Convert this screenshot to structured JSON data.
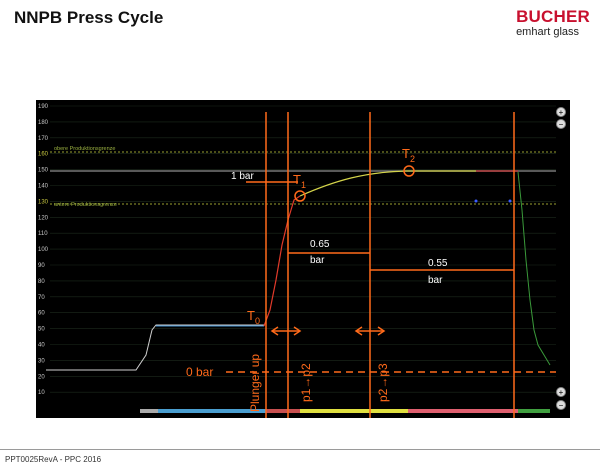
{
  "page": {
    "title": "NNPB Press Cycle",
    "logo": {
      "brand": "BUCHER",
      "sub": "emhart glass"
    },
    "footer": "PPT0025RevA - PPC 2016"
  },
  "scope": {
    "y_ticks": [
      "190",
      "180",
      "170",
      "160",
      "150",
      "140",
      "130",
      "120",
      "110",
      "100",
      "90",
      "80",
      "70",
      "60",
      "50",
      "40",
      "30",
      "20",
      "10"
    ],
    "limit_upper": "obere Produktionsgrenze",
    "limit_lower": "untere Produktionsgrenze",
    "limit_upper_tick": "160",
    "limit_lower_tick": "130",
    "zoom_in": "+",
    "zoom_out": "−"
  },
  "annotations": {
    "t0": "T",
    "t0_sub": "0",
    "t1": "T",
    "t1_sub": "1",
    "t2": "T",
    "t2_sub": "2",
    "one_bar": "1 bar",
    "p065": "0.65",
    "p065_unit": "bar",
    "p055": "0.55",
    "p055_unit": "bar",
    "zero_bar": "0 bar",
    "plunger_up": "Plunger up",
    "p1p2": "p1→p2",
    "p2p3": "p2→p3"
  },
  "colors": {
    "accent": "#ff6a1a",
    "scope_bg": "#000000",
    "trace": "#d4d44a"
  }
}
